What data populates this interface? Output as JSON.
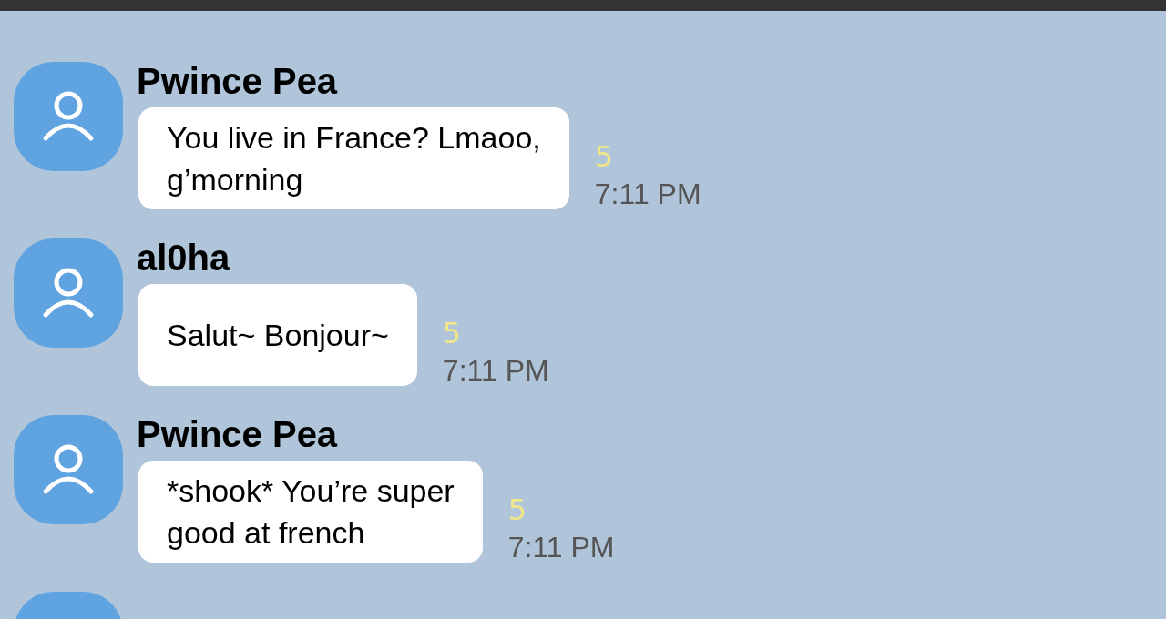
{
  "messages": [
    {
      "sender": "Pwince Pea",
      "text": "You live in France? Lmaoo,\ng’morning",
      "unread": "5",
      "time": "7:11 PM"
    },
    {
      "sender": "al0ha",
      "text": "Salut~ Bonjour~",
      "unread": "5",
      "time": "7:11 PM"
    },
    {
      "sender": "Pwince Pea",
      "text": "*shook* You’re super\ngood at french",
      "unread": "5",
      "time": "7:11 PM"
    }
  ],
  "next_message_peek": true
}
